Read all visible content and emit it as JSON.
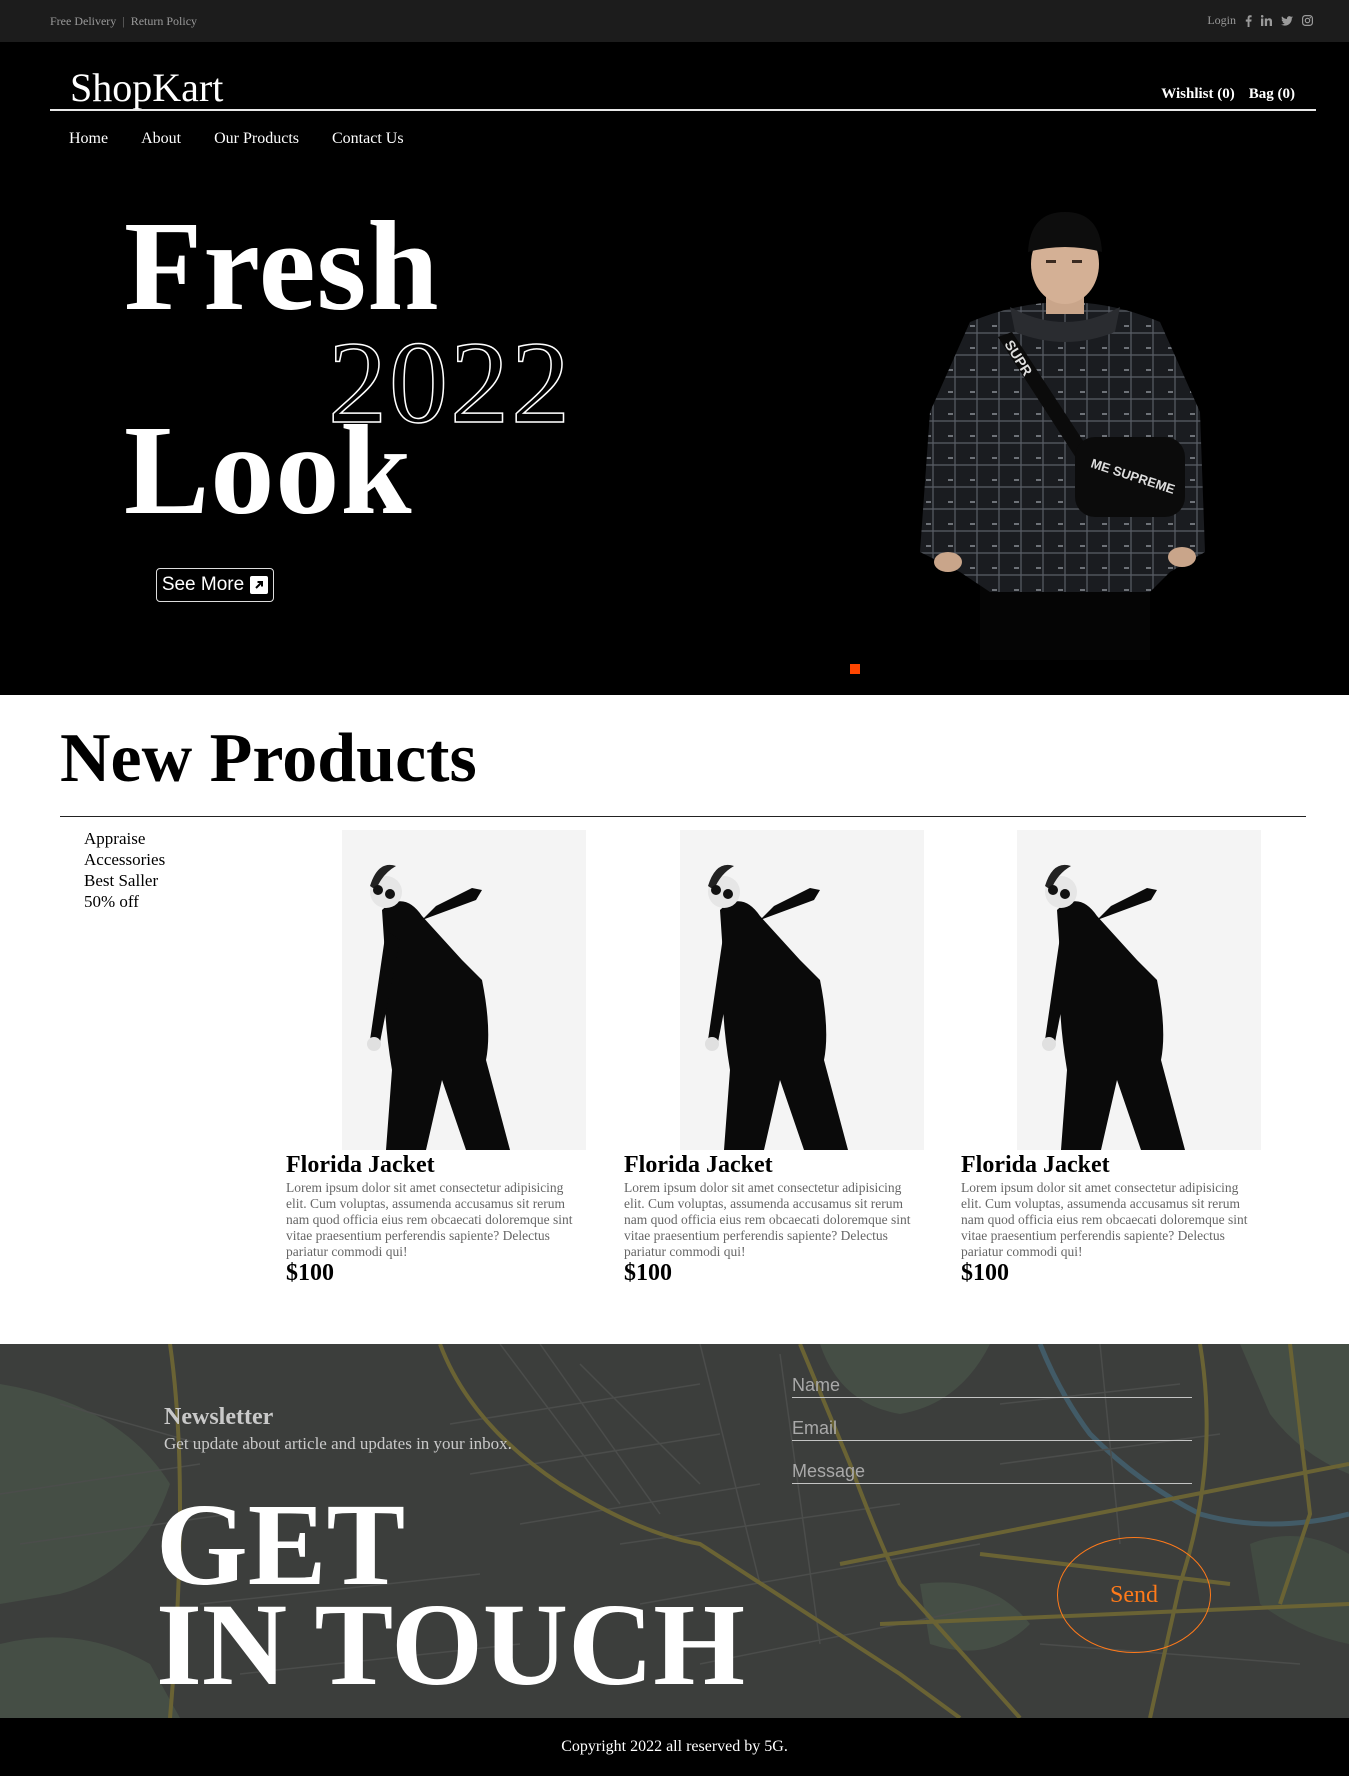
{
  "topbar": {
    "free_delivery": "Free Delivery",
    "divider": "|",
    "return_policy": "Return Policy",
    "login": "Login",
    "social_icons": [
      "facebook-icon",
      "linkedin-icon",
      "twitter-icon",
      "instagram-icon"
    ]
  },
  "header": {
    "logo": "ShopKart",
    "wishlist": "Wishlist (0)",
    "bag": "Bag (0)",
    "nav": [
      "Home",
      "About",
      "Our Products",
      "Contact Us"
    ]
  },
  "hero": {
    "line1": "Fresh",
    "year": "2022",
    "line2": "Look",
    "cta": "See More",
    "active_slide_color": "#ff4500"
  },
  "products": {
    "title": "New Products",
    "categories": [
      "Appraise",
      "Accessories",
      "Best Saller",
      "50% off"
    ],
    "items": [
      {
        "name": "Florida Jacket",
        "description": "Lorem ipsum dolor sit amet consectetur adipisicing elit. Cum voluptas, assumenda accusamus sit rerum nam quod officia eius rem obcaecati doloremque sint vitae praesentium perferendis sapiente? Delectus pariatur commodi qui!",
        "price": "$100"
      },
      {
        "name": "Florida Jacket",
        "description": "Lorem ipsum dolor sit amet consectetur adipisicing elit. Cum voluptas, assumenda accusamus sit rerum nam quod officia eius rem obcaecati doloremque sint vitae praesentium perferendis sapiente? Delectus pariatur commodi qui!",
        "price": "$100"
      },
      {
        "name": "Florida Jacket",
        "description": "Lorem ipsum dolor sit amet consectetur adipisicing elit. Cum voluptas, assumenda accusamus sit rerum nam quod officia eius rem obcaecati doloremque sint vitae praesentium perferendis sapiente? Delectus pariatur commodi qui!",
        "price": "$100"
      }
    ]
  },
  "newsletter": {
    "title": "Newsletter",
    "subtitle": "Get update about article and updates in your inbox.",
    "headline_line1": "GET",
    "headline_line2": "IN TOUCH",
    "name_placeholder": "Name",
    "email_placeholder": "Email",
    "message_placeholder": "Message",
    "send": "Send",
    "accent_color": "#ff7a1a"
  },
  "footer": {
    "copyright": "Copyright 2022 all reserved by 5G."
  }
}
